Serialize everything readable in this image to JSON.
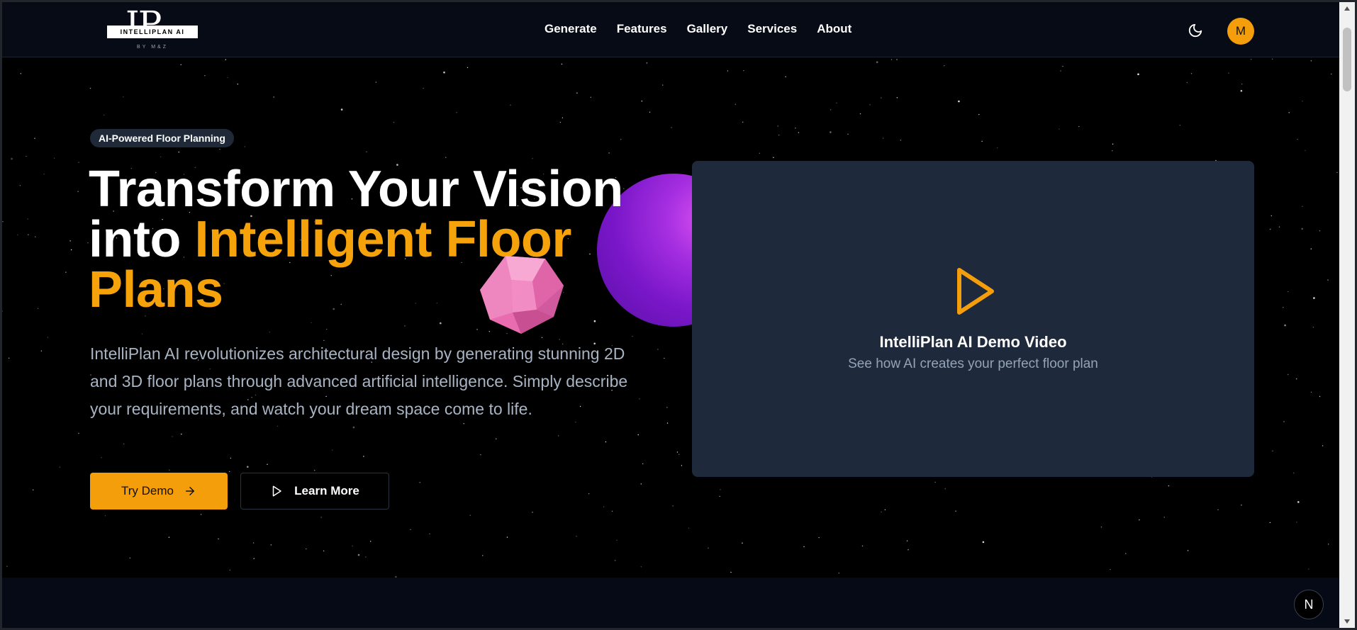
{
  "header": {
    "logo": {
      "letters": "IP",
      "band_text": "INTELLIPLAN AI",
      "sub_text": "BY M&Z"
    },
    "nav": [
      {
        "label": "Generate"
      },
      {
        "label": "Features"
      },
      {
        "label": "Gallery"
      },
      {
        "label": "Services"
      },
      {
        "label": "About"
      }
    ],
    "theme_toggle_icon": "moon-icon",
    "avatar_initial": "M"
  },
  "hero": {
    "badge": "AI-Powered Floor Planning",
    "headline": {
      "line1": "Transform Your Vision",
      "line2_prefix": "into ",
      "accent": "Intelligent Floor Plans"
    },
    "description": "IntelliPlan AI revolutionizes architectural design by generating stunning 2D and 3D floor plans through advanced artificial intelligence. Simply describe your requirements, and watch your dream space come to life.",
    "primary_button": {
      "label": "Try Demo",
      "icon": "arrow-right-icon"
    },
    "secondary_button": {
      "label": "Learn More",
      "icon": "play-icon"
    },
    "video": {
      "title": "IntelliPlan AI Demo Video",
      "subtitle": "See how AI creates your perfect floor plan",
      "icon": "play-icon"
    }
  },
  "dev_badge": {
    "label": "N"
  },
  "colors": {
    "accent": "#f59e0b",
    "header_bg": "#070b16",
    "card_bg": "#1e293b",
    "sphere": "#8b1fd6",
    "gem": "#ef7fbf"
  }
}
